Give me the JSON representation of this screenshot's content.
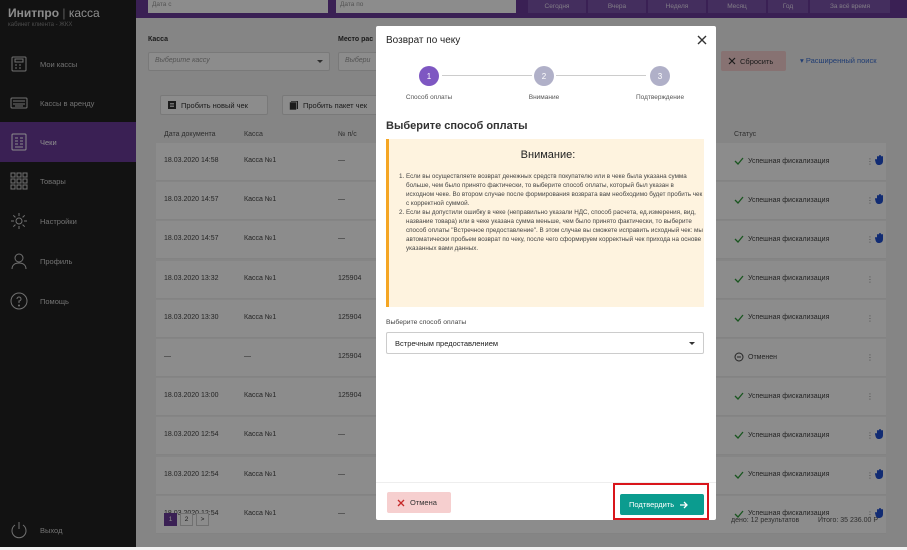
{
  "sidebar": {
    "brand": "Инитпро",
    "brand_sep": "|",
    "brand_product": "касса",
    "brand_sub": "кабинет клиента - ЖКХ",
    "items": [
      {
        "label": "Мои кассы",
        "icon": "cash-register-icon"
      },
      {
        "label": "Кассы в аренду",
        "icon": "keyboard-icon"
      },
      {
        "label": "Чеки",
        "icon": "receipt-icon",
        "active": true
      },
      {
        "label": "Товары",
        "icon": "grid-icon"
      },
      {
        "label": "Настройки",
        "icon": "gear-icon"
      },
      {
        "label": "Профиль",
        "icon": "user-icon"
      },
      {
        "label": "Помощь",
        "icon": "help-icon"
      }
    ],
    "logout": "Выход"
  },
  "topbar": {
    "date_from": "Дата с",
    "date_to": "Дата по",
    "periods": [
      "Сегодня",
      "Вчера",
      "Неделя",
      "Месяц",
      "Год",
      "За всё время"
    ]
  },
  "filters": {
    "kassa_label": "Касса",
    "kassa_placeholder": "Выберите кассу",
    "place_label": "Место рас",
    "place_placeholder": "Выбери",
    "reset": "Сбросить",
    "advanced": "Расширенный поиск"
  },
  "actions": {
    "new_check": "Пробить новый чек",
    "batch": "Пробить пакет чек"
  },
  "table": {
    "headers": {
      "date": "Дата документа",
      "kassa": "Касса",
      "num": "№ п/с",
      "status": "Статус"
    },
    "rows": [
      {
        "date": "18.03.2020 14:58",
        "kassa": "Касса №1",
        "num": "—",
        "status": "Успешная фискализация",
        "ok": true,
        "hand": true
      },
      {
        "date": "18.03.2020 14:57",
        "kassa": "Касса №1",
        "num": "—",
        "status": "Успешная фискализация",
        "ok": true,
        "hand": true
      },
      {
        "date": "18.03.2020 14:57",
        "kassa": "Касса №1",
        "num": "—",
        "status": "Успешная фискализация",
        "ok": true,
        "hand": true
      },
      {
        "date": "18.03.2020 13:32",
        "kassa": "Касса №1",
        "num": "125904",
        "status": "Успешная фискализация",
        "ok": true,
        "hand": false
      },
      {
        "date": "18.03.2020 13:30",
        "kassa": "Касса №1",
        "num": "125904",
        "status": "Успешная фискализация",
        "ok": true,
        "hand": false
      },
      {
        "date": "—",
        "kassa": "—",
        "num": "125904",
        "status": "Отменен",
        "ok": false,
        "hand": false
      },
      {
        "date": "18.03.2020 13:00",
        "kassa": "Касса №1",
        "num": "125904",
        "status": "Успешная фискализация",
        "ok": true,
        "hand": false
      },
      {
        "date": "18.03.2020 12:54",
        "kassa": "Касса №1",
        "num": "—",
        "status": "Успешная фискализация",
        "ok": true,
        "hand": true
      },
      {
        "date": "18.03.2020 12:54",
        "kassa": "Касса №1",
        "num": "—",
        "status": "Успешная фискализация",
        "ok": true,
        "hand": true
      },
      {
        "date": "18.03.2020 12:54",
        "kassa": "Касса №1",
        "num": "—",
        "status": "Успешная фискализация",
        "ok": true,
        "hand": true
      }
    ]
  },
  "pagination": {
    "pages": [
      "1",
      "2"
    ],
    "next": ">",
    "found": "дено: 12 результатов",
    "total": "Итого: 35 236.00 Р"
  },
  "modal": {
    "title": "Возврат по чеку",
    "steps": [
      {
        "num": "1",
        "label": "Способ оплаты",
        "active": true
      },
      {
        "num": "2",
        "label": "Внимание",
        "active": false
      },
      {
        "num": "3",
        "label": "Подтверждение",
        "active": false
      }
    ],
    "section_title": "Выберите способ оплаты",
    "warning_title": "Внимание:",
    "warning_items": [
      "Если вы осуществляете возврат денежных средств покупателю или в чеке была указана сумма больше, чем было принято фактически, то выберите способ оплаты, который был указан в исходном чеке. Во втором случае после формирования возврата вам необходимо будет пробить чек с корректной суммой.",
      "Если вы допустили ошибку в чеке (неправильно указали НДС, способ расчета, ед.измерения, вид, название товара) или в чеке указана сумма меньше, чем было принято фактически, то выберите способ оплаты \"Встречное предоставление\". В этом случае вы сможете исправить исходный чек: мы автоматически пробьем возврат по чеку, после чего сформируем корректный чек прихода на основе указанных вами данных."
    ],
    "pay_label": "Выберите способ оплаты",
    "pay_value": "Встречным предоставлением",
    "cancel": "Отмена",
    "confirm": "Подтвердить"
  },
  "colors": {
    "accent": "#6a3b9a",
    "teal": "#0b9c8f",
    "success": "#2e9c3a",
    "highlight": "#d9151b"
  }
}
